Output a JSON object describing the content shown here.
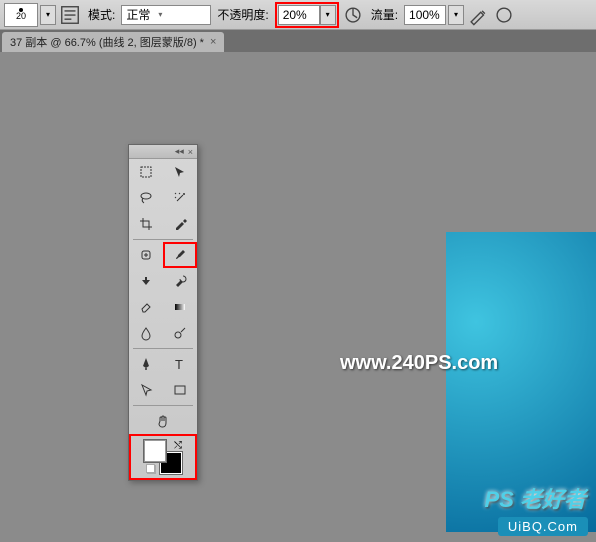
{
  "toolbar": {
    "brush_size": "20",
    "mode_label": "模式:",
    "mode_value": "正常",
    "opacity_label": "不透明度:",
    "opacity_value": "20%",
    "flow_label": "流量:",
    "flow_value": "100%"
  },
  "tab": {
    "title": "37 副本 @ 66.7% (曲线 2, 图层蒙版/8) *"
  },
  "watermarks": {
    "url": "www.240PS.com",
    "brand": "PS 老好者",
    "site": "UiBQ.Com"
  },
  "colors": {
    "foreground": "#ffffff",
    "background": "#000000",
    "accent": "#0f8ab3",
    "highlight": "#ff0000"
  },
  "tools": {
    "panel_collapse": "◂◂",
    "panel_close": "×"
  }
}
